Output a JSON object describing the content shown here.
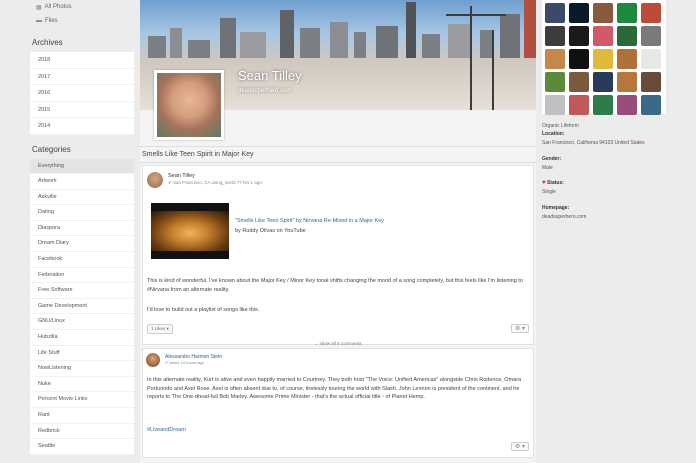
{
  "sidebar": {
    "top_items": [
      {
        "label": "All Photos",
        "icon": "photos-icon"
      },
      {
        "label": "Files",
        "icon": "folder-icon"
      }
    ],
    "archives_heading": "Archives",
    "archives": [
      "2018",
      "2017",
      "2016",
      "2015",
      "2014"
    ],
    "categories_heading": "Categories",
    "categories": [
      "Everything",
      "Artwork",
      "Askville",
      "Dating",
      "Diaspora",
      "Dream Diary",
      "Facebook",
      "Federation",
      "Free Software",
      "Game Development",
      "GNU/Linux",
      "Hubzilla",
      "Life Stuff",
      "NowListening",
      "Nuke",
      "Percent Movie Links",
      "Rant",
      "Redbrick",
      "Seattle"
    ]
  },
  "profile": {
    "name": "Sean Tilley",
    "url": "deadsuperhero.com"
  },
  "post": {
    "title": "Smells Like Teen Spirit in Major Key",
    "author": "Sean Tilley",
    "meta": "✔ San Francisco, CA using_world 77 hrs 1 ago",
    "video_title": "\"Smells Like Teen Spirit\" by Nirvana Re-Mixed in a Major Key",
    "video_by": "by Ruddy Olivas on YouTube",
    "text1": "This is kind of wonderful. I've known about the Major Key / Minor Key tonal shifts changing the mood of a song completely, but this feels like I'm listening to #Nirvana from an alternate reality.",
    "text2": "I'd love to build out a playlist of songs like this.",
    "like_label": "1 Likes ▾",
    "gear_label": "⚙ ▾"
  },
  "comments": {
    "show_all": "⌄ show all 8 comments",
    "author": "Alessandro Harmon Stein",
    "meta": "✔ about 10 hours ago",
    "text": "In this alternate reality, Kurt is alive and even happily married to Courtney. They both host \"The Voice: Unified Americas\" alongside Chris Rodence, Omara Portuondo and Axel Rose. Axel is often absent due to, of course, tirelessly touring the world with Slash. John Lennon is president of the continent, and he reports to The One-dread-full Bob Marley. Awesome Prime Minister - that's the actual official title - of Planet Hemp.",
    "hashtag": "#LiveandDream",
    "gear_label": "⚙ ▾"
  },
  "right": {
    "contacts": [
      "#3a4a6b",
      "#0a1a2a",
      "#8a5a3c",
      "#1c8a3c",
      "#c04a3a",
      "#3c3c3c",
      "#1a1a1a",
      "#d05a6a",
      "#2a6a3a",
      "#7a7a7a",
      "#c4894a",
      "#101010",
      "#e0b83a",
      "#b0703a",
      "#e8e8e8",
      "#5a8a3a",
      "#7a5a3a",
      "#2a3a5a",
      "#b7773c",
      "#6a4a3a",
      "#c0c0c0",
      "#c05a5a",
      "#2c7c4c",
      "#9a4c7a",
      "#3a6a8a"
    ],
    "organization": "Organic Lifeform",
    "location_label": "Location:",
    "location_value": "San Francisco, California 94103 United States",
    "gender_label": "Gender:",
    "gender_value": "Male",
    "status_label": "Status:",
    "status_value": "Single",
    "homepage_label": "Homepage:",
    "homepage_value": "deadsuperhero.com"
  }
}
